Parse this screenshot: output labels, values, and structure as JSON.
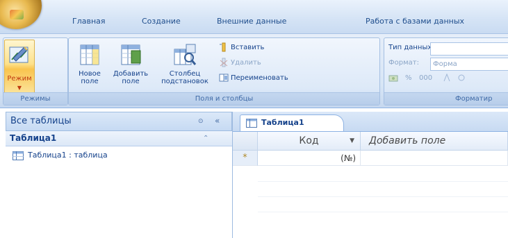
{
  "tabs": [
    {
      "label": "Главная"
    },
    {
      "label": "Создание"
    },
    {
      "label": "Внешние данные"
    },
    {
      "label": "Работа с базами данных"
    }
  ],
  "ribbon": {
    "mode": {
      "label": "Режим",
      "group": "Режимы"
    },
    "fields_group": {
      "label": "Поля и столбцы",
      "new_field": "Новое поле",
      "add_field": "Добавить поле",
      "lookup_column": "Столбец подстановок",
      "insert": "Вставить",
      "delete": "Удалить",
      "rename": "Переименовать"
    },
    "format_group": {
      "label": "Форматир",
      "data_type": "Тип данных:",
      "format": "Формат:",
      "format_value": "Форма",
      "percent": "%",
      "thousands": "000"
    }
  },
  "nav": {
    "header": "Все таблицы",
    "group": "Таблица1",
    "item": "Таблица1 : таблица"
  },
  "document": {
    "tab": "Таблица1",
    "columns": [
      {
        "label": "Код"
      },
      {
        "label": "Добавить поле"
      }
    ],
    "new_row": {
      "marker": "*",
      "id": "(№)"
    }
  },
  "colors": {
    "ribbon_bg": "#d7e5f6",
    "text": "#15428b",
    "active_button": "#f9c44f"
  }
}
